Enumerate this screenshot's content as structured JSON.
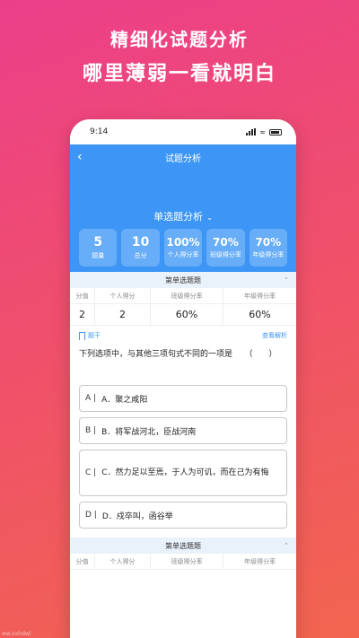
{
  "promo": {
    "line1": "精细化试题分析",
    "line2": "哪里薄弱一看就明白"
  },
  "status_bar": {
    "time": "9:14"
  },
  "header": {
    "title": "试题分析",
    "section_select": "单选题分析"
  },
  "stats": [
    {
      "value": "5",
      "label": "题量"
    },
    {
      "value": "10",
      "label": "总分"
    },
    {
      "value": "100%",
      "label": "个人得分率"
    },
    {
      "value": "70%",
      "label": "班级得分率"
    },
    {
      "value": "70%",
      "label": "年级得分率"
    }
  ],
  "question_section": {
    "band_title": "第单选题题",
    "columns": [
      "分值",
      "个人得分",
      "班级得分率",
      "年级得分率"
    ],
    "row": [
      "2",
      "2",
      "60%",
      "60%"
    ],
    "stem_tag": "题干",
    "view_analysis": "查看解析",
    "question_text": "下列选项中，与其他三项句式不同的一项是　　（　　）",
    "options": [
      {
        "letter": "A |",
        "text": "A．聚之咸阳"
      },
      {
        "letter": "B |",
        "text": "B．将军战河北，臣战河南"
      },
      {
        "letter": "C |",
        "text": "C．然力足以至焉，于人为可讥，而在己为有悔"
      },
      {
        "letter": "D |",
        "text": "D．戍卒叫，函谷举"
      }
    ]
  },
  "next_section": {
    "band_title": "第单选题题",
    "columns": [
      "分值",
      "个人得分",
      "班级得分率",
      "年级得分率"
    ]
  },
  "colors": {
    "accent": "#3d96f5",
    "gradient_start": "#ec3f8a",
    "gradient_end": "#f2654f"
  },
  "watermark": "ww.xxhdwl"
}
